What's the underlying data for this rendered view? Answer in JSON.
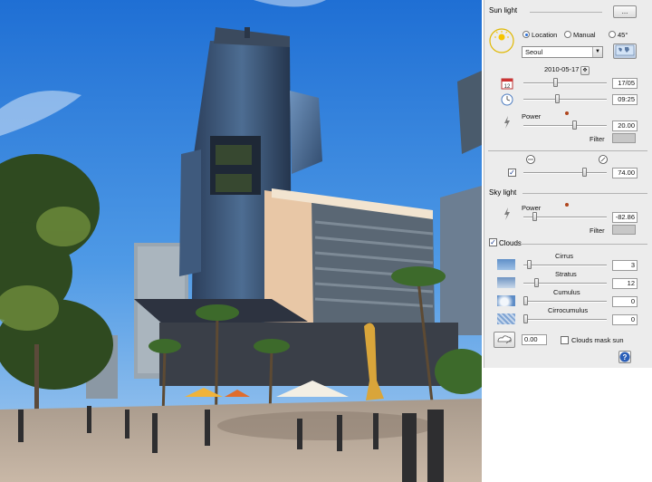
{
  "sunlight": {
    "title": "Sun light",
    "more_button": "...",
    "mode_location": "Location",
    "mode_manual": "Manual",
    "mode_45": "45°",
    "city": "Seoul",
    "date": "2010-05-17",
    "date_value": "17/05",
    "time_value": "09:25",
    "power_label": "Power",
    "power_value": "20.00",
    "filter_label": "Filter",
    "haze_value": "74.00"
  },
  "skylight": {
    "title": "Sky light",
    "power_label": "Power",
    "power_value": "-82.86",
    "filter_label": "Filter"
  },
  "clouds": {
    "title": "Clouds",
    "cirrus_label": "Cirrus",
    "cirrus_value": "3",
    "stratus_label": "Stratus",
    "stratus_value": "12",
    "cumulus_label": "Cumulus",
    "cumulus_value": "0",
    "cirrocumulus_label": "Cirrocumulus",
    "cirrocumulus_value": "0",
    "wind_value": "0.00",
    "mask_label": "Clouds mask sun"
  },
  "colors": {
    "sky": "#2f7fd9",
    "panel": "#ececec",
    "accent": "#2b6fd6"
  },
  "icons": [
    "sun-icon",
    "world-map-icon",
    "calendar-icon",
    "clock-icon",
    "lightning-icon",
    "haze-icon",
    "cloud-icon",
    "help-icon"
  ]
}
